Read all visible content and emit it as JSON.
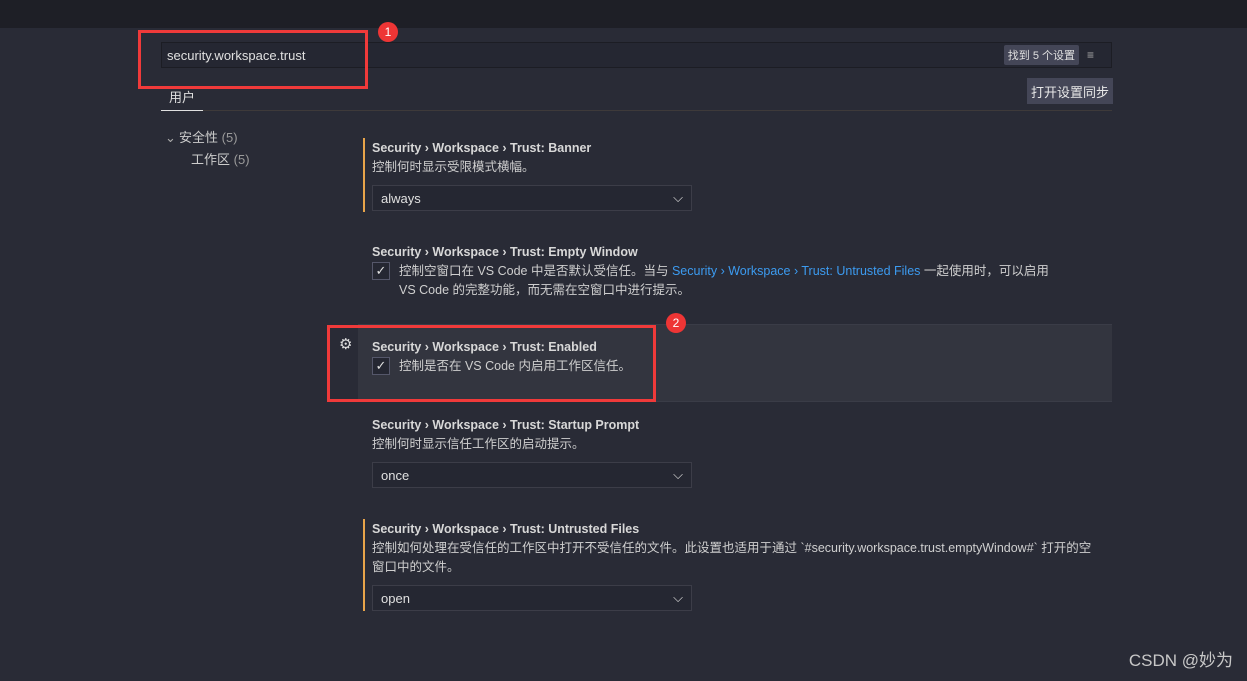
{
  "search": {
    "value": "security.workspace.trust",
    "result_count": "找到 5 个设置",
    "clear_icon": "clear-filter-icon"
  },
  "tabs": [
    {
      "label": "用户"
    }
  ],
  "sync_button": "打开设置同步",
  "tree": [
    {
      "label": "安全性",
      "count": "(5)"
    },
    {
      "label": "工作区",
      "count": "(5)"
    }
  ],
  "settings": [
    {
      "title": "Security › Workspace › Trust: Banner",
      "desc": "控制何时显示受限模式横幅。",
      "value": "always",
      "modified": true
    },
    {
      "title": "Security › Workspace › Trust: Empty Window",
      "desc_pre": "控制空窗口在 VS Code 中是否默认受信任。当与 ",
      "desc_link": "Security › Workspace › Trust: Untrusted Files",
      "desc_post": " 一起使用时，可以启用 VS Code 的完整功能，而无需在空窗口中进行提示。",
      "checked": true
    },
    {
      "title": "Security › Workspace › Trust: Enabled",
      "desc": "控制是否在 VS Code 内启用工作区信任。",
      "checked": true
    },
    {
      "title": "Security › Workspace › Trust: Startup Prompt",
      "desc": "控制何时显示信任工作区的启动提示。",
      "value": "once"
    },
    {
      "title": "Security › Workspace › Trust: Untrusted Files",
      "desc": "控制如何处理在受信任的工作区中打开不受信任的文件。此设置也适用于通过 `#security.workspace.trust.emptyWindow#` 打开的空窗口中的文件。",
      "value": "open",
      "modified": true
    }
  ],
  "annotations": [
    {
      "label": "1"
    },
    {
      "label": "2"
    }
  ],
  "watermark": "CSDN @妙为",
  "colors": {
    "modified_bar": "#e8a44a",
    "link": "#3c9bf0",
    "annotation": "#f03a3a"
  }
}
